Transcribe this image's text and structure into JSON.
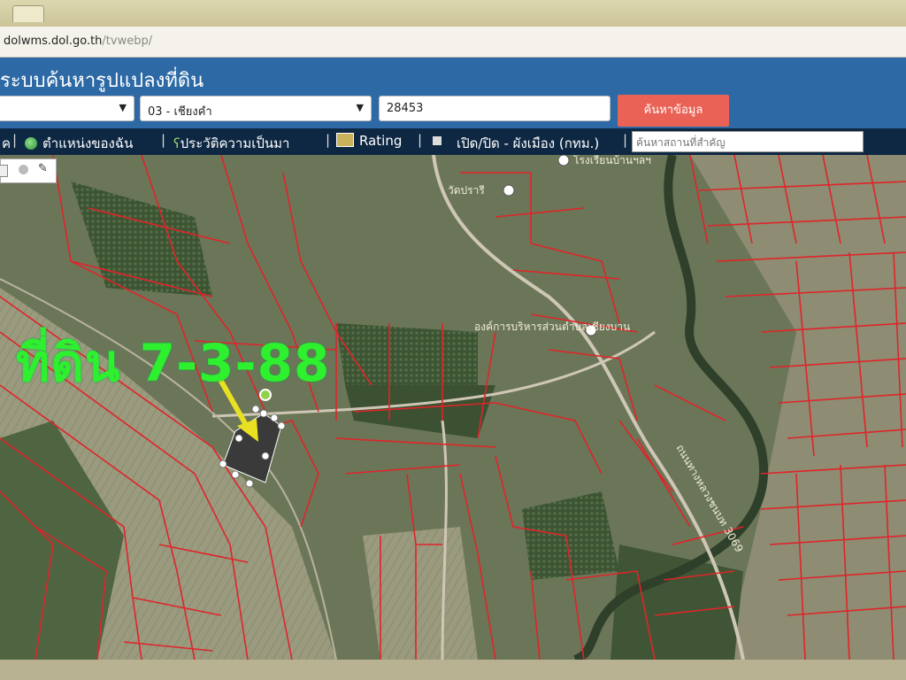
{
  "browser": {
    "url_host": "dolwms.dol.go.th",
    "url_path": "/tvwebp/"
  },
  "header": {
    "title": "ระบบค้นหารูปแปลงที่ดิน",
    "amphoe_select": "03 - เชียงคำ",
    "parcel_input": "28453",
    "search_button": "ค้นหาข้อมูล"
  },
  "toolbar": {
    "item_cut": "ค",
    "my_location": "ตำแหน่งของฉัน",
    "history": "ประวัติความเป็นมา",
    "rating": "Rating",
    "toggle_cityplan": "เปิด/ปิด - ผังเมือง (กทม.)",
    "place_search_placeholder": "ค้นหาสถานที่สำคัญ"
  },
  "map": {
    "plot_label": "ที่ดิน 7-3-88",
    "label_school": "โรงเรียนบ้านฯลฯ",
    "label_temple": "วัดปรารี",
    "label_office": "องค์การบริหารส่วนตำบลเชียงบาน",
    "label_road": "ถนนทางหลวงชนบท 3069",
    "colors": {
      "parcel_line": "#e0242a",
      "selected_plot": "#3a3a3a",
      "label_green": "#2ef02e",
      "arrow": "#e8e020"
    }
  }
}
